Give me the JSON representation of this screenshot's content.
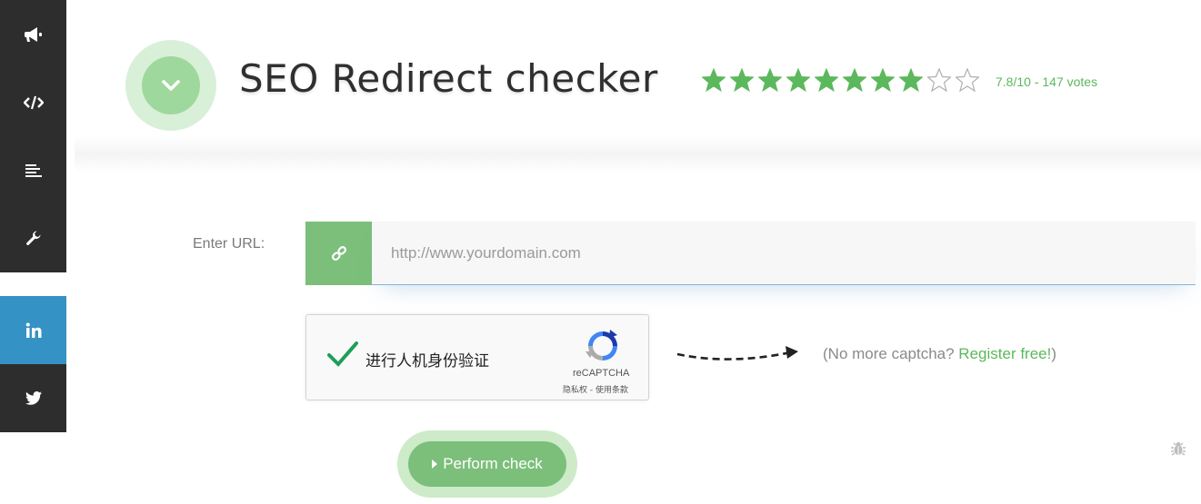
{
  "sidebar": {
    "items": [
      {
        "icon": "megaphone-icon"
      },
      {
        "icon": "code-icon"
      },
      {
        "icon": "align-left-icon"
      },
      {
        "icon": "wrench-icon"
      },
      {
        "icon": "linkedin-icon"
      },
      {
        "icon": "twitter-icon"
      }
    ]
  },
  "header": {
    "title": "SEO Redirect checker",
    "rating": {
      "score": 7.8,
      "max": 10,
      "filled_stars": 8,
      "total_stars": 10,
      "text": "7.8/10 - 147 votes"
    }
  },
  "form": {
    "url_label": "Enter URL:",
    "url_placeholder": "http://www.yourdomain.com",
    "captcha": {
      "label": "进行人机身份验证",
      "brand": "reCAPTCHA",
      "links": "隐私权 - 使用条款"
    },
    "no_captcha_prefix": "(No more captcha? ",
    "register_link": "Register free!",
    "no_captcha_suffix": ")",
    "submit_label": "Perform check"
  },
  "colors": {
    "accent_green": "#7bbf7a",
    "sidebar_dark": "#2d2d2d",
    "linkedin_blue": "#3592c4",
    "star_green": "#5cb85c"
  }
}
